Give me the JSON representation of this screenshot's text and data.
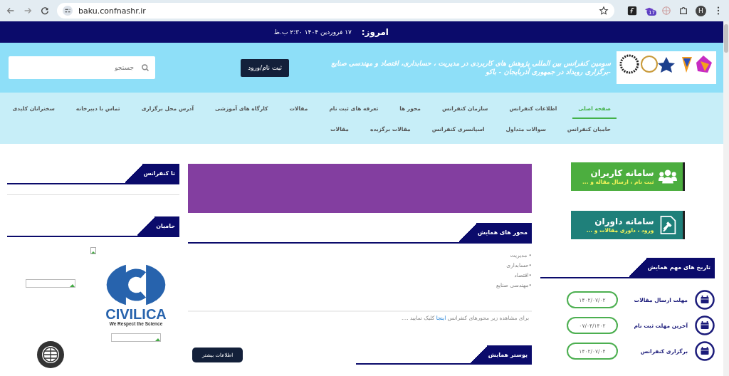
{
  "browser": {
    "url": "baku.confnashr.ir",
    "badge": "17",
    "avatar": "H"
  },
  "topbar": {
    "label": "امروز:",
    "date": "۱۷ فروردین ۱۴۰۴ ۲:۳۰ ب.ظ"
  },
  "header": {
    "title": "سومین کنفرانس بین المللی پژوهش های کاربردی در مدیریت ، حسابداری، اقتصاد و مهندسی صنایع -برگزاری رویداد در جمهوری آذربایجان - باکو",
    "login_button": "ثبت نام/ورود",
    "search": {
      "placeholder": "جستجو"
    }
  },
  "nav": [
    [
      {
        "label": "صفحه اصلی",
        "selected": true
      },
      {
        "label": "اطلاعات کنفرانس",
        "selected": false
      },
      {
        "label": "سازمان کنفرانس",
        "selected": false
      },
      {
        "label": "محور ها",
        "selected": false
      },
      {
        "label": "تعرفه های ثبت نام",
        "selected": false
      },
      {
        "label": "مقالات",
        "selected": false
      },
      {
        "label": "کارگاه های آموزشی",
        "selected": false
      },
      {
        "label": "آدرس محل برگزاری",
        "selected": false
      },
      {
        "label": "تماس با دبیرخانه",
        "selected": false
      },
      {
        "label": "سخنرانان کلیدی",
        "selected": false
      }
    ],
    [
      {
        "label": "حامیان کنفرانس",
        "selected": false
      },
      {
        "label": "سوالات متداول",
        "selected": false
      },
      {
        "label": "اسپانسری کنفرانس",
        "selected": false
      },
      {
        "label": "مقالات برگزیده",
        "selected": false
      },
      {
        "label": "مقالات",
        "selected": false
      }
    ]
  ],
  "left": {
    "countdown_heading": "تا کنفرانس",
    "sponsors_heading": "حامیان",
    "sponsor_logo": {
      "name": "CIVILICA",
      "tagline": "We Respect the Science"
    }
  },
  "center": {
    "axes_heading": "محور های همایش",
    "axes": [
      "• مدیریت",
      "•حسابداری",
      "•اقتصاد",
      "•مهندسی صنایع"
    ],
    "note": {
      "before": "برای مشاهده زیر محورهای کنفرانس ",
      "link": "اینجا",
      "after": " کلیک نمایید ...."
    },
    "poster_heading": "پوستر همایش",
    "more_button": "اطلاعات بیشتر"
  },
  "right": {
    "cards": [
      {
        "kind": "users",
        "title": "سامانه کاربران",
        "subtitle": "ثبت نام ، ارسال مقاله و ..."
      },
      {
        "kind": "referees",
        "title": "سامانه داوران",
        "subtitle": "ورود ، داوری مقالات و ..."
      }
    ],
    "dates_heading": "تاریخ های مهم همایش",
    "dates": [
      {
        "label": "مهلت ارسال مقالات",
        "date": "۱۴۰۲/۰۷/۰۲"
      },
      {
        "label": "آخرین مهلت ثبت نام",
        "date": "۰۷/۰۴/۱۴۰۲"
      },
      {
        "label": "برگزاری کنفرانس",
        "date": "۱۴۰۲/۰۷/۰۴"
      }
    ]
  }
}
